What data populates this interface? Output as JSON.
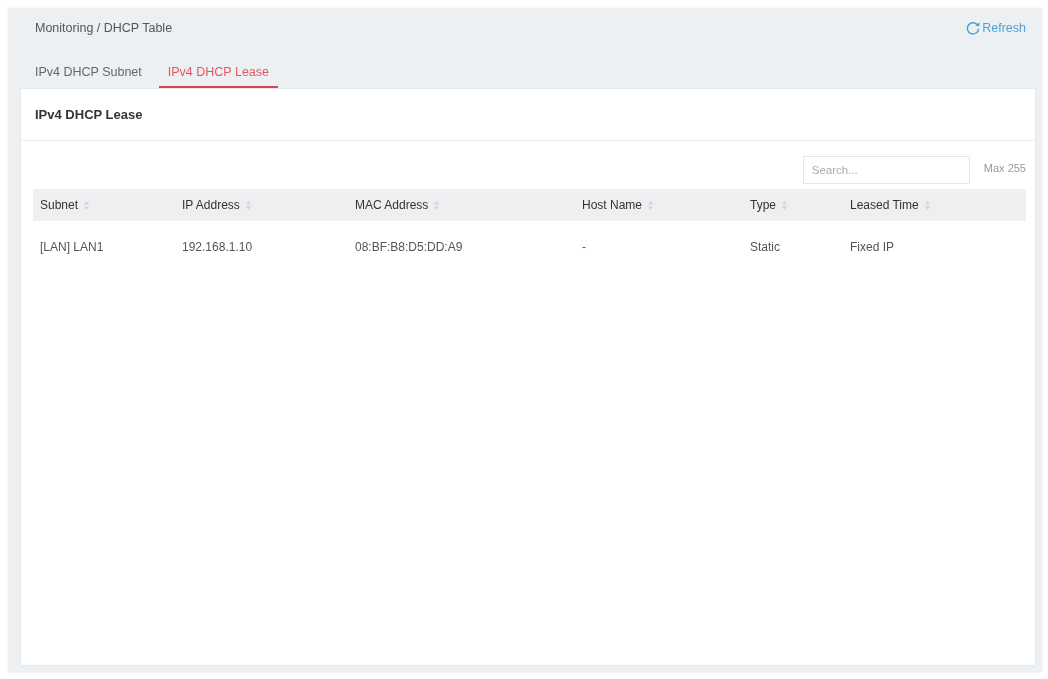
{
  "breadcrumb": "Monitoring / DHCP Table",
  "refresh": {
    "label": "Refresh"
  },
  "tabs": [
    {
      "label": "IPv4 DHCP Subnet",
      "selected": false
    },
    {
      "label": "IPv4 DHCP Lease",
      "selected": true
    }
  ],
  "card": {
    "title": "IPv4 DHCP Lease",
    "search": {
      "placeholder": "Search..."
    },
    "limit_note": "Max 255",
    "table": {
      "columns": [
        {
          "label": "Subnet",
          "sortable": true
        },
        {
          "label": "IP Address",
          "sortable": true
        },
        {
          "label": "MAC Address",
          "sortable": true
        },
        {
          "label": "Host Name",
          "sortable": true
        },
        {
          "label": "Type",
          "sortable": true
        },
        {
          "label": "Leased Time",
          "sortable": true
        }
      ],
      "rows": [
        [
          "[LAN] LAN1",
          "192.168.1.10",
          "08:BF:B8:D5:DD:A9",
          "-",
          "Static",
          "Fixed IP"
        ]
      ]
    }
  }
}
